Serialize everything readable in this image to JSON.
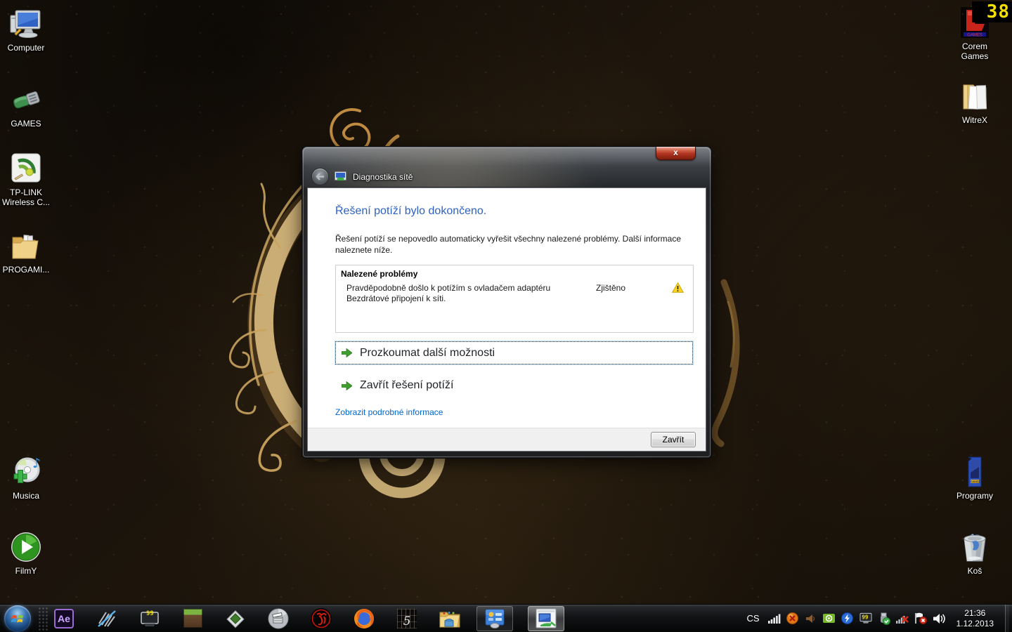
{
  "fps_counter": {
    "value": "38"
  },
  "desktop": {
    "icons_left": [
      {
        "label": "Computer"
      },
      {
        "label": "GAMES"
      },
      {
        "label": "TP-LINK",
        "label2": "Wireless C..."
      },
      {
        "label": "PROGAMI..."
      },
      {
        "label": "Musica"
      },
      {
        "label": "FilmY"
      }
    ],
    "icons_right": [
      {
        "label": "Corem",
        "label2": "Games"
      },
      {
        "label": "WitreX"
      },
      {
        "label": "Programy"
      },
      {
        "label": "Koš"
      }
    ]
  },
  "dialog": {
    "title": "Diagnostika sítě",
    "close_glyph": "x",
    "heading": "Řešení potíží bylo dokončeno.",
    "body": "Řešení potíží se nepovedlo automaticky vyřešit všechny nalezené problémy. Další informace naleznete níže.",
    "problems": {
      "header": "Nalezené problémy",
      "rows": [
        {
          "line1": "Pravděpodobně došlo k potížím s ovladačem adaptéru",
          "line2": "Bezdrátové připojení k síti.",
          "status": "Zjištěno",
          "severity_icon": "warning-triangle"
        }
      ]
    },
    "actions": [
      {
        "label": "Prozkoumat další možnosti",
        "focused": true
      },
      {
        "label": "Zavřít řešení potíží",
        "focused": false
      }
    ],
    "details_link": "Zobrazit podrobné informace",
    "close_button": "Zavřít"
  },
  "taskbar": {
    "apps": [
      {
        "name": "after-effects",
        "badge": "Ae"
      },
      {
        "name": "vegas"
      },
      {
        "name": "fraps",
        "badge": "99"
      },
      {
        "name": "minecraft"
      },
      {
        "name": "video-converter"
      },
      {
        "name": "movie-maker"
      },
      {
        "name": "scorpion-game"
      },
      {
        "name": "firefox"
      },
      {
        "name": "game-5",
        "badge": "5"
      },
      {
        "name": "windows-explorer"
      },
      {
        "name": "control-panel",
        "active": true
      },
      {
        "name": "network-diagnostics",
        "active": true,
        "foreground": true
      }
    ],
    "tray": {
      "language": "CS",
      "fps": "99",
      "clock_time": "21:36",
      "clock_date": "1.12.2013"
    }
  },
  "colors": {
    "heading_blue": "#2e62c1",
    "link_blue": "#0066cc",
    "warning_yellow": "#ffd428",
    "arrow_green": "#3f9e2d",
    "close_red": "#b03421",
    "gold_ornament": "#d6b97e"
  }
}
